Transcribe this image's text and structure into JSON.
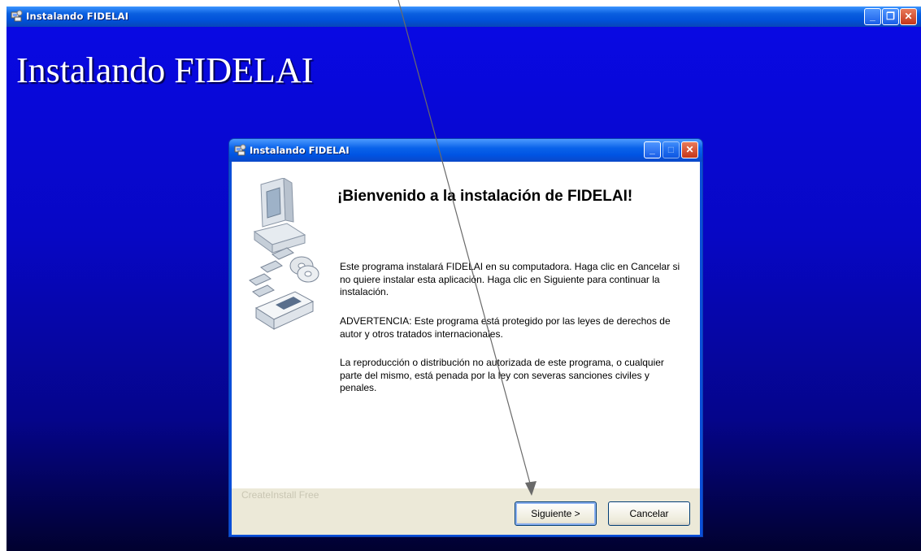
{
  "outer_window": {
    "title": "Instalando FIDELAI",
    "heading": "Instalando FIDELAI",
    "controls": {
      "minimize": "_",
      "restore": "❐",
      "close": "✕"
    }
  },
  "dialog": {
    "title": "Instalando FIDELAI",
    "welcome": "¡Bienvenido a la instalación de FIDELAI!",
    "paragraphs": [
      "Este programa instalará FIDELAI en su computadora. Haga clic en Cancelar si no quiere instalar esta aplicación. Haga clic en Siguiente para continuar la instalación.",
      "ADVERTENCIA: Este programa está protegido por las leyes de derechos de autor y otros tratados internacionales.",
      "La reproducción o distribución no autorizada de este programa, o cualquier parte del mismo, está penada por la ley con severas sanciones civiles y penales."
    ],
    "brand": "CreateInstall Free",
    "buttons": {
      "next": "Siguiente >",
      "cancel": "Cancelar"
    },
    "controls": {
      "minimize": "_",
      "maximize": "□",
      "close": "✕"
    }
  },
  "icons": [
    "installer-icon",
    "computer-disk-illustration-icon"
  ]
}
